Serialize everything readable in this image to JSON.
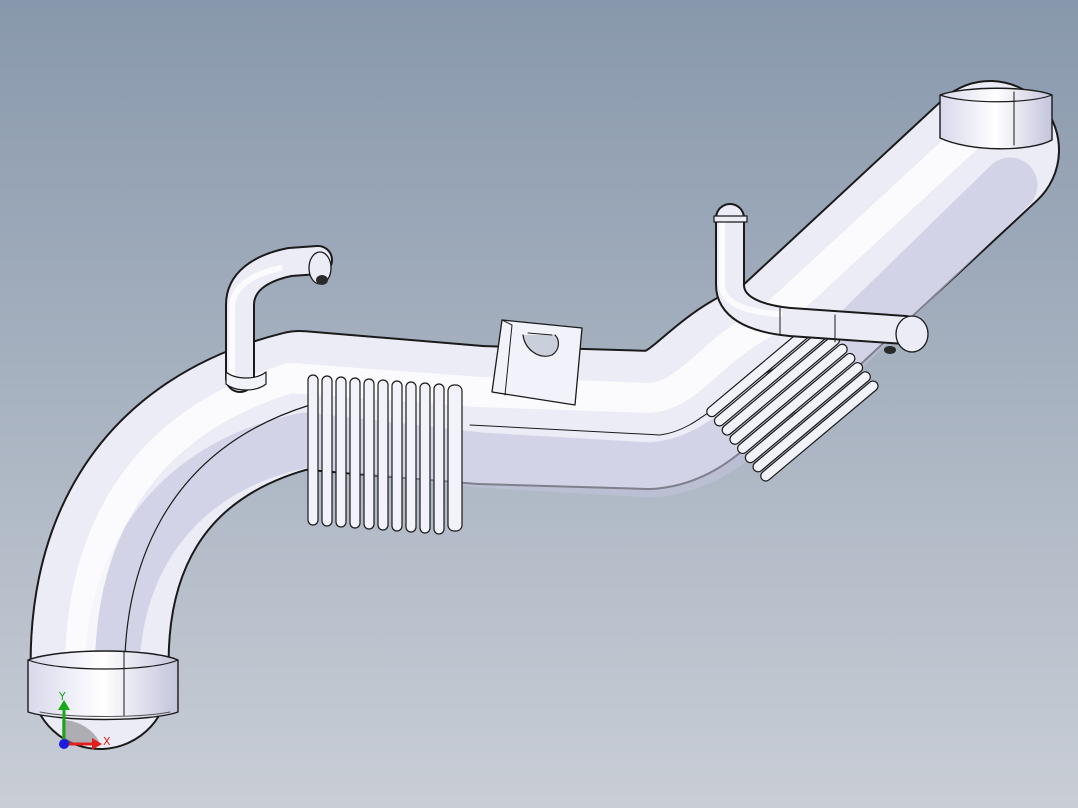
{
  "viewport": {
    "background_top": "#8898ac",
    "background_bottom": "#c9ced6"
  },
  "model": {
    "body_color": "#ececf7",
    "edge_color": "#1a1a1a",
    "shade_color": "#b8b8d2",
    "highlight_color": "#ffffff"
  },
  "triad": {
    "y_label": "Y",
    "x_label": "X",
    "y_color": "#18a818",
    "x_color": "#e02020",
    "origin_color": "#1c1ce0"
  }
}
